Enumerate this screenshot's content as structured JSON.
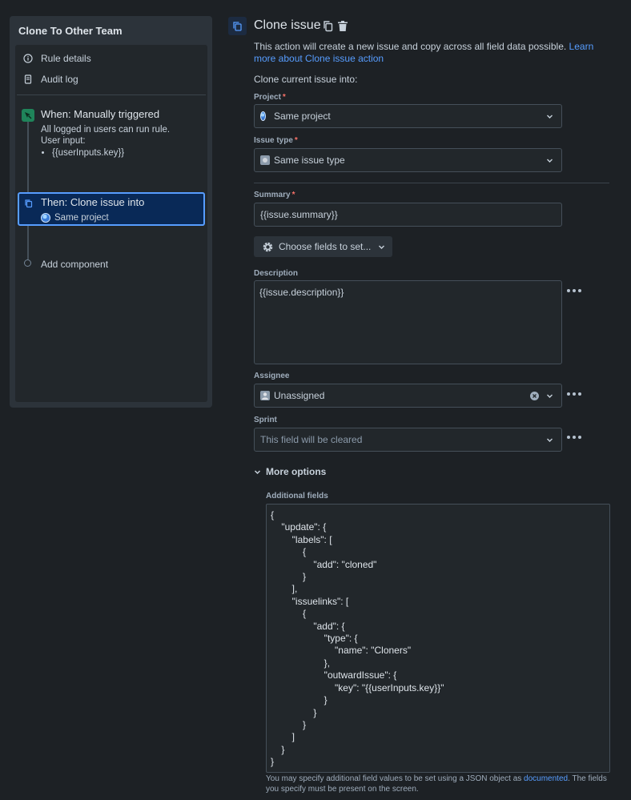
{
  "rule": {
    "title": "Clone To Other Team",
    "nav": [
      {
        "label": "Rule details",
        "icon": "info-icon"
      },
      {
        "label": "Audit log",
        "icon": "document-icon"
      }
    ],
    "trigger": {
      "title": "When: Manually triggered",
      "desc_line1": "All logged in users can run rule.",
      "desc_line2": "User input:",
      "input_item": "{{userInputs.key}}"
    },
    "action": {
      "title": "Then: Clone issue into",
      "subtitle": "Same project"
    },
    "add_component": "Add component"
  },
  "config": {
    "title": "Clone issue",
    "intro_text": "This action will create a new issue and copy across all field data possible. ",
    "learn_more": "Learn more about Clone issue action",
    "clone_into": "Clone current issue into:",
    "project": {
      "label": "Project",
      "required": "*",
      "value": "Same project"
    },
    "issue_type": {
      "label": "Issue type",
      "required": "*",
      "value": "Same issue type"
    },
    "summary": {
      "label": "Summary",
      "required": "*",
      "value": "{{issue.summary}}"
    },
    "choose_fields": "Choose fields to set...",
    "description": {
      "label": "Description",
      "value": "{{issue.description}}"
    },
    "assignee": {
      "label": "Assignee",
      "value": "Unassigned"
    },
    "sprint": {
      "label": "Sprint",
      "placeholder": "This field will be cleared"
    },
    "more_options": "More options",
    "additional_fields": {
      "label": "Additional fields",
      "json": "{\n    \"update\": {\n        \"labels\": [\n            {\n                \"add\": \"cloned\"\n            }\n        ],\n        \"issuelinks\": [\n            {\n                \"add\": {\n                    \"type\": {\n                        \"name\": \"Cloners\"\n                    },\n                    \"outwardIssue\": {\n                        \"key\": \"{{userInputs.key}}\"\n                    }\n                }\n            }\n        ]\n    }\n}",
      "help_before": "You may specify additional field values to be set using a JSON object as ",
      "help_link": "documented",
      "help_after": ". The fields you specify must be present on the screen."
    }
  },
  "colors": {
    "accent": "#579dff",
    "selected_bg": "#092957",
    "trigger_green": "#1f845a",
    "required_red": "#f87168"
  }
}
